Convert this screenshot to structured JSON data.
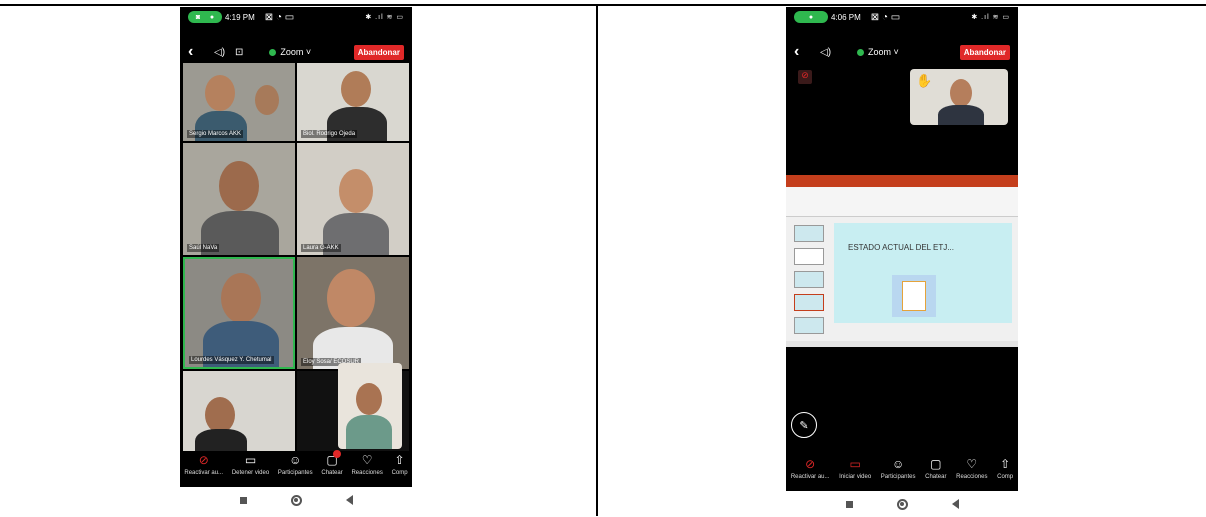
{
  "left_phone": {
    "status": {
      "time": "4:19 PM",
      "status_icons": "⊠ ◔ ▭",
      "right_icons": "✱ .ıl ≋ ▭"
    },
    "topbar": {
      "meeting_label": "Zoom ˅",
      "leave_button": "Abandonar"
    },
    "tiles": [
      {
        "name": "Sergio Marcos AKK"
      },
      {
        "name": "Biol. Rodrigo Ojeda"
      },
      {
        "name": "Saúl NaVa"
      },
      {
        "name": "Laura G-AKK"
      },
      {
        "name": "Lourdes Vásquez Y. Chetumal"
      },
      {
        "name": "Eloy Sosa/ ECOSUR"
      },
      {
        "name": ""
      },
      {
        "name": ""
      }
    ],
    "toolbar": {
      "audio": "Reactivar au...",
      "video": "Detener video",
      "participants": "Participantes",
      "chat": "Chatear",
      "reactions": "Reacciones",
      "share": "Comp"
    }
  },
  "right_phone": {
    "status": {
      "time": "4:06 PM",
      "status_icons": "⊠ ◔ ▭",
      "right_icons": "✱ .ıl ≋ ▭"
    },
    "topbar": {
      "meeting_label": "Zoom ˅",
      "leave_button": "Abandonar"
    },
    "slide": {
      "title": "ESTADO ACTUAL DEL ETJ..."
    },
    "toolbar": {
      "audio": "Reactivar au...",
      "video": "Iniciar video",
      "participants": "Participantes",
      "chat": "Chatear",
      "reactions": "Reacciones",
      "share": "Comp"
    }
  },
  "colors": {
    "leave": "#e02828",
    "zoom_dot": "#2fb84f",
    "slide_bg": "#c8eef2",
    "ribbon": "#c43e1c"
  }
}
